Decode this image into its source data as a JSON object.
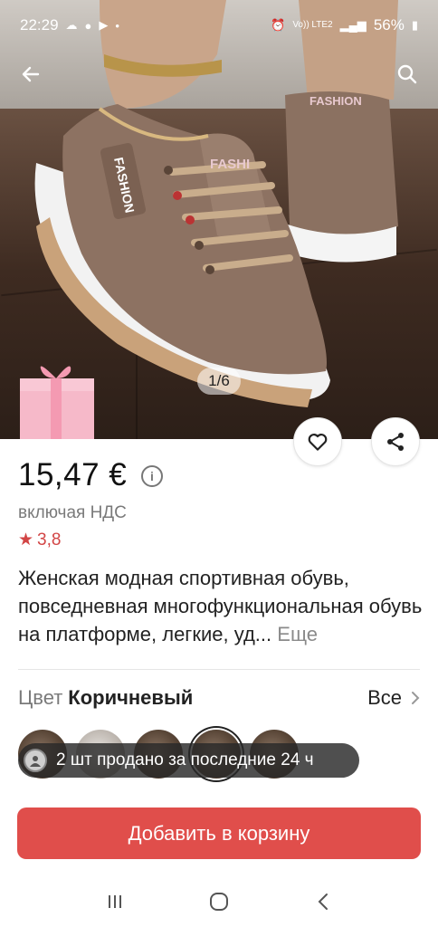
{
  "status_bar": {
    "time": "22:29",
    "battery": "56%",
    "network": "Vo)) LTE2"
  },
  "gallery": {
    "counter": "1/6",
    "brand_print": "FASHION"
  },
  "product": {
    "price": "15,47 €",
    "vat_note": "включая НДС",
    "rating": "3,8",
    "title": "Женская модная спортивная обувь, повседневная многофункциональная обувь на платформе, легкие, уд...",
    "more_link": "Еще"
  },
  "color_selector": {
    "label": "Цвет",
    "value": "Коричневый",
    "all_link": "Все"
  },
  "sold_notice": "2 шт продано за последние 24 ч",
  "cart_button": "Добавить в корзину",
  "colors": {
    "accent": "#e04e4b",
    "rating_star": "#d24545"
  },
  "icons": [
    "back-arrow-icon",
    "search-icon",
    "heart-icon",
    "share-icon",
    "info-icon",
    "star-icon",
    "chevron-right-icon",
    "gift-icon"
  ]
}
